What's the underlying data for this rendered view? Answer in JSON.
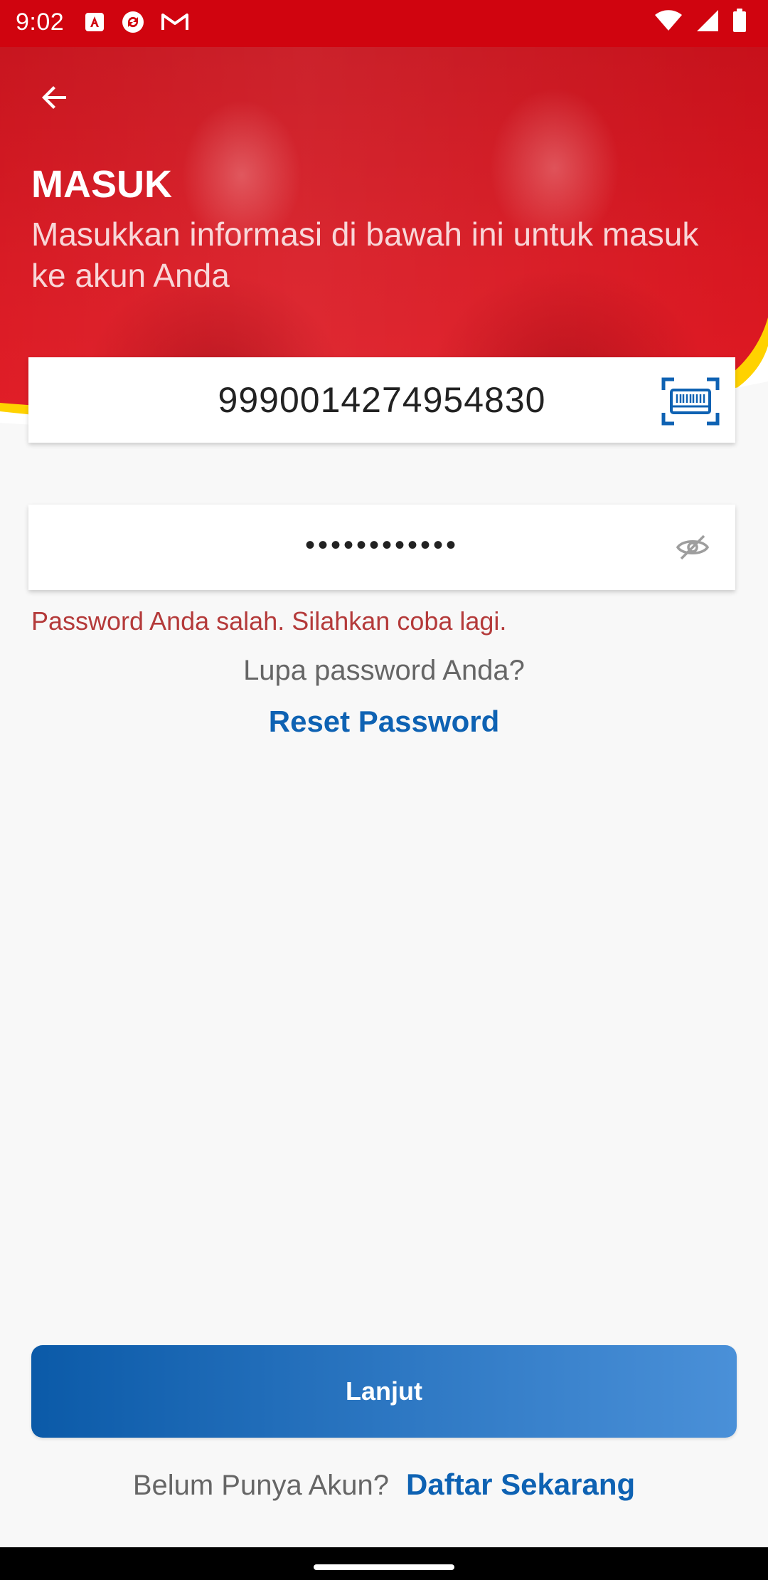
{
  "status_bar": {
    "time": "9:02",
    "left_icons": [
      "adobe-acrobat-icon",
      "sync-app-icon",
      "gmail-icon"
    ],
    "right_icons": [
      "wifi-icon",
      "signal-icon",
      "battery-icon"
    ]
  },
  "header": {
    "back_icon": "arrow-left-icon",
    "title": "MASUK",
    "subtitle": "Masukkan informasi di bawah ini untuk masuk ke akun Anda"
  },
  "form": {
    "account_number": "9990014274954830",
    "password_masked": "••••••••••••",
    "scan_icon": "barcode-scan-icon",
    "toggle_icon": "eye-off-icon",
    "error_message": "Password Anda salah. Silahkan coba lagi.",
    "forgot_prompt": "Lupa password Anda?",
    "reset_link": "Reset Password"
  },
  "actions": {
    "submit_label": "Lanjut",
    "register_prompt": "Belum Punya Akun?",
    "register_link": "Daftar Sekarang"
  },
  "colors": {
    "brand_red": "#d0040f",
    "accent_yellow": "#ffd200",
    "link_blue": "#0e62b3",
    "button_gradient_start": "#0b5aa8",
    "button_gradient_end": "#4a90d8",
    "error_red": "#b43a3a"
  }
}
